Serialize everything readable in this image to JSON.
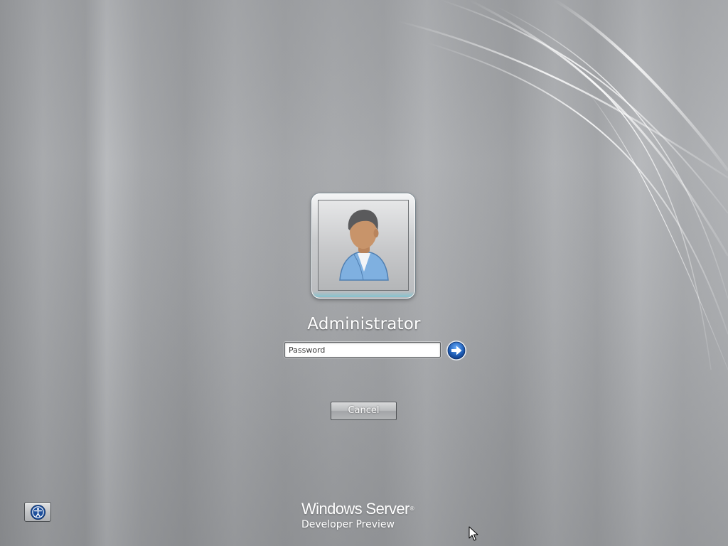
{
  "login": {
    "user_name": "Administrator",
    "password_placeholder": "Password",
    "cancel_label": "Cancel"
  },
  "branding": {
    "product_name": "Windows Server",
    "trademark": "®",
    "edition": "Developer Preview"
  },
  "icons": {
    "avatar": "user-avatar-icon",
    "submit": "arrow-right-icon",
    "ease_of_access": "ease-of-access-icon",
    "cursor": "mouse-pointer-icon"
  },
  "colors": {
    "background": "#a4a6a9",
    "text": "#ffffff",
    "submit_button": "#1f5fb8",
    "avatar_shirt": "#7fb0e0",
    "avatar_skin": "#c8946a"
  }
}
